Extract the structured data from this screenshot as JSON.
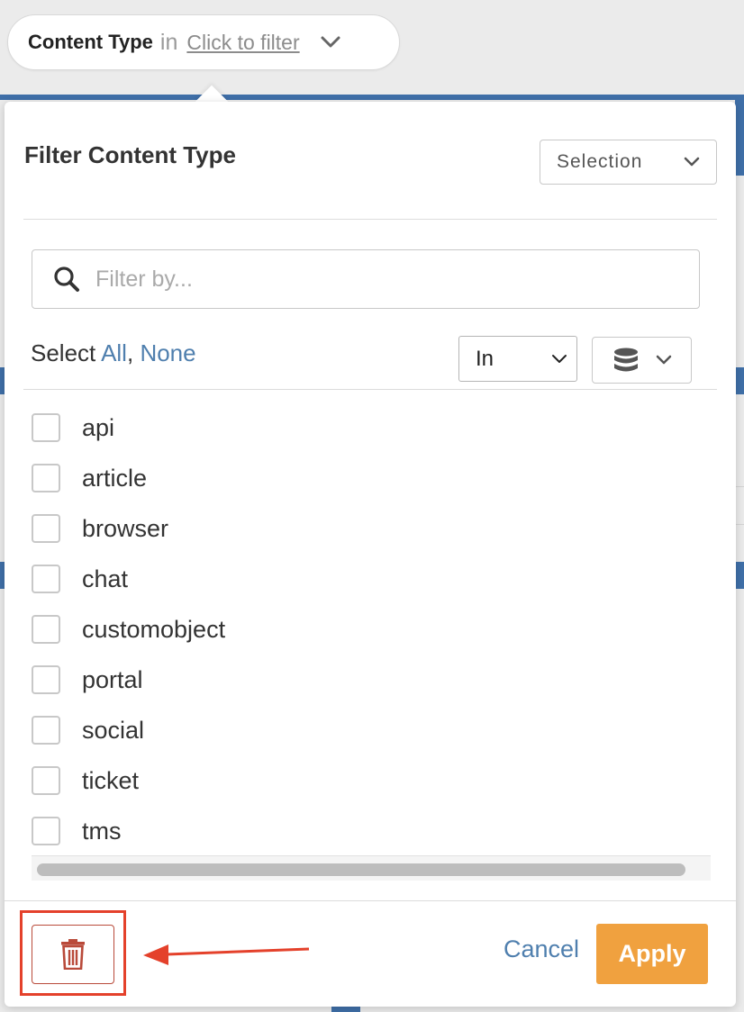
{
  "filter_pill": {
    "field": "Content Type",
    "operator_word": "in",
    "link_text": "Click to filter",
    "chevron_icon": "chevron-down-icon"
  },
  "popover": {
    "title": "Filter Content Type",
    "mode_select": {
      "value": "Selection",
      "icon": "chevron-down-icon"
    },
    "search": {
      "placeholder": "Filter by...",
      "value": "",
      "icon": "search-icon"
    },
    "select_row": {
      "prefix": "Select",
      "all_link": "All",
      "separator": ",",
      "none_link": "None"
    },
    "operator_select": {
      "value": "In",
      "icon": "chevron-down-icon"
    },
    "source_button": {
      "icon": "database-icon",
      "chevron": "chevron-down-icon"
    },
    "items": [
      {
        "label": "api",
        "checked": false
      },
      {
        "label": "article",
        "checked": false
      },
      {
        "label": "browser",
        "checked": false
      },
      {
        "label": "chat",
        "checked": false
      },
      {
        "label": "customobject",
        "checked": false
      },
      {
        "label": "portal",
        "checked": false
      },
      {
        "label": "social",
        "checked": false
      },
      {
        "label": "ticket",
        "checked": false
      },
      {
        "label": "tms",
        "checked": false
      }
    ],
    "footer": {
      "delete_icon": "trash-icon",
      "cancel_label": "Cancel",
      "apply_label": "Apply"
    }
  },
  "annotation": {
    "highlight_color": "#e4412b",
    "arrow_icon": "arrow-left-icon"
  },
  "colors": {
    "accent_link": "#4f7fae",
    "apply_button": "#f0a13f",
    "danger": "#b94a3a"
  }
}
